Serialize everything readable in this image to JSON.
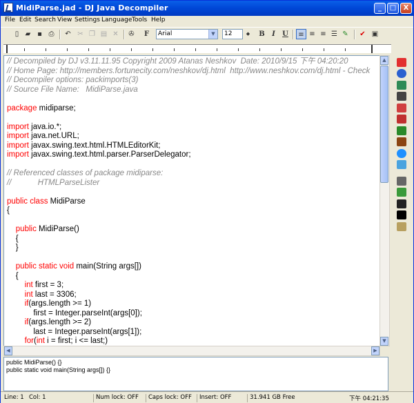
{
  "window": {
    "title": "MidiParse.jad - DJ Java Decompiler",
    "controls": {
      "minimize": "_",
      "maximize": "□",
      "close": "X"
    }
  },
  "menu": [
    "File",
    "Edit",
    "Search",
    "View",
    "Settings",
    "Language",
    "Tools",
    "Help"
  ],
  "toolbar": {
    "font_name": "Arial",
    "font_size": "12",
    "bold": "B",
    "italic": "I",
    "underline": "U",
    "font_button": "F"
  },
  "code_lines": [
    {
      "cls": "c",
      "text": "// Decompiled by DJ v3.11.11.95 Copyright 2009 Atanas Neshkov  Date: 2010/9/15 下午 04:20:20"
    },
    {
      "cls": "c",
      "text": "// Home Page: http://members.fortunecity.com/neshkov/dj.html  http://www.neshkov.com/dj.html - Check"
    },
    {
      "cls": "c",
      "text": "// Decompiler options: packimports(3)"
    },
    {
      "cls": "c",
      "text": "// Source File Name:   MidiParse.java"
    },
    {
      "cls": "",
      "text": ""
    },
    {
      "kw": "package",
      "rest": " midiparse;"
    },
    {
      "cls": "",
      "text": ""
    },
    {
      "kw": "import",
      "rest": " java.io.*;"
    },
    {
      "kw": "import",
      "rest": " java.net.URL;"
    },
    {
      "kw": "import",
      "rest": " javax.swing.text.html.HTMLEditorKit;"
    },
    {
      "kw": "import",
      "rest": " javax.swing.text.html.parser.ParserDelegator;"
    },
    {
      "cls": "",
      "text": ""
    },
    {
      "cls": "c",
      "text": "// Referenced classes of package midiparse:"
    },
    {
      "cls": "c",
      "text": "//            HTMLParseLister"
    },
    {
      "cls": "",
      "text": ""
    },
    {
      "kw": "public class",
      "rest": " MidiParse"
    },
    {
      "cls": "",
      "text": "{"
    },
    {
      "cls": "",
      "text": ""
    },
    {
      "indent": "    ",
      "kw": "public",
      "rest": " MidiParse()"
    },
    {
      "cls": "",
      "text": "    {"
    },
    {
      "cls": "",
      "text": "    }"
    },
    {
      "cls": "",
      "text": ""
    },
    {
      "indent": "    ",
      "kw": "public static void",
      "rest": " main(String args[])"
    },
    {
      "cls": "",
      "text": "    {"
    },
    {
      "indent": "        ",
      "kw": "int",
      "rest": " first = 3;"
    },
    {
      "indent": "        ",
      "kw": "int",
      "rest": " last = 3306;"
    },
    {
      "indent": "        ",
      "kw": "if",
      "rest": "(args.length >= 1)"
    },
    {
      "cls": "",
      "text": "            first = Integer.parseInt(args[0]);"
    },
    {
      "indent": "        ",
      "kw": "if",
      "rest": "(args.length >= 2)"
    },
    {
      "cls": "",
      "text": "            last = Integer.parseInt(args[1]);"
    },
    {
      "indent": "        ",
      "kw": "for",
      "rest": "(",
      "kw2": "int",
      "rest2": " i = first; i <= last;)"
    }
  ],
  "outline": [
    "public MidiParse() {}",
    "public static void main(String args[]) {}"
  ],
  "status": {
    "line": "Line:   1",
    "col": "Col:   1",
    "numlock": "Num lock: OFF",
    "capslock": "Caps lock: OFF",
    "insert": "Insert: OFF",
    "free": "31.941 GB Free",
    "time": "下午 04:21:35"
  },
  "colors": {
    "comment": "#888888",
    "keyword": "#ff0000",
    "titlebar": "#0047d6"
  }
}
